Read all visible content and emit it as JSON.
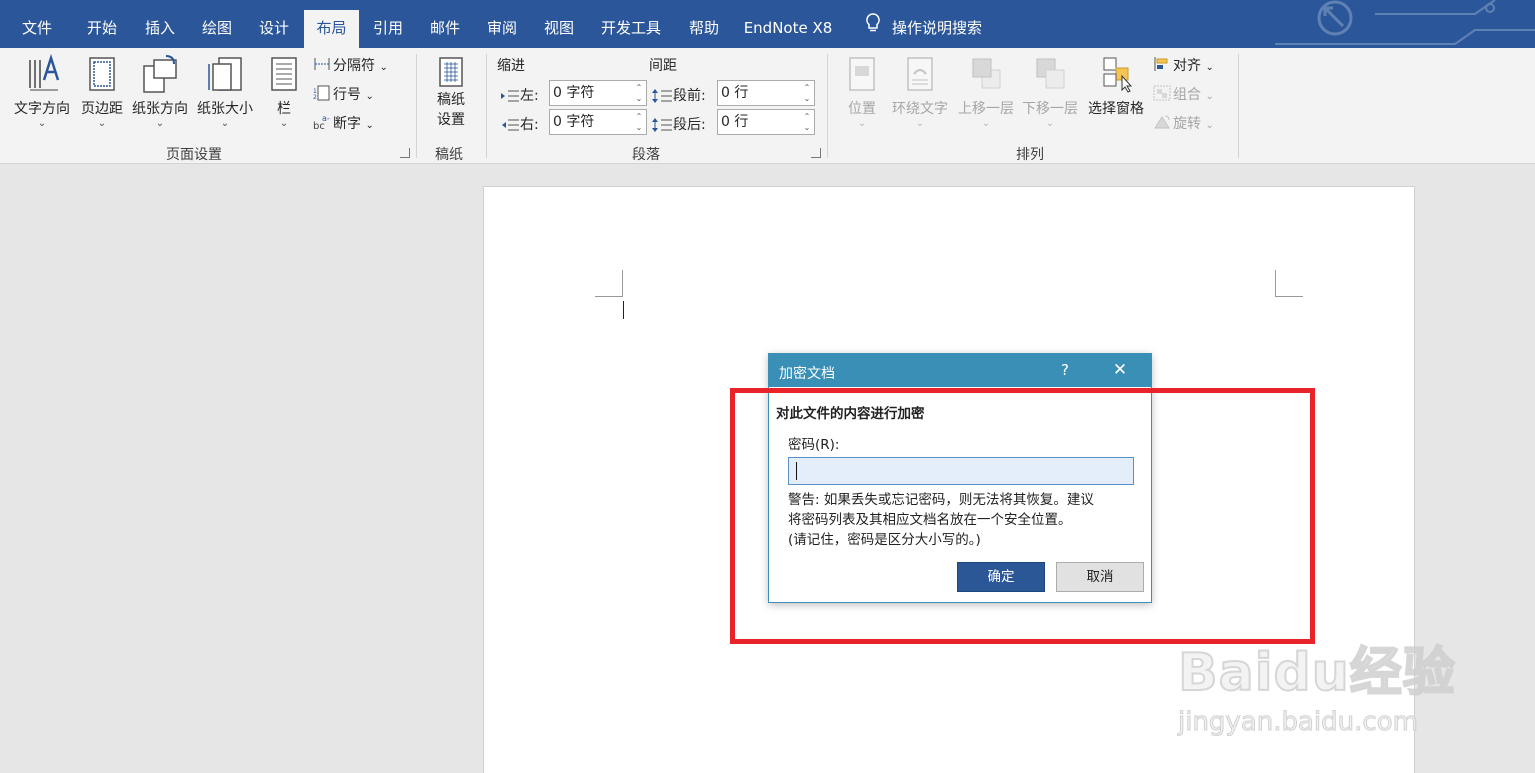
{
  "tabs": [
    "文件",
    "开始",
    "插入",
    "绘图",
    "设计",
    "布局",
    "引用",
    "邮件",
    "审阅",
    "视图",
    "开发工具",
    "帮助",
    "EndNote X8"
  ],
  "active_tab": "布局",
  "tell_me": "操作说明搜索",
  "ribbon": {
    "page_setup": {
      "text_direction": "文字方向",
      "margins": "页边距",
      "orientation": "纸张方向",
      "size": "纸张大小",
      "columns": "栏",
      "breaks": "分隔符",
      "line_numbers": "行号",
      "hyphenation": "断字",
      "group_label": "页面设置"
    },
    "draft_paper": {
      "button_line1": "稿纸",
      "button_line2": "设置",
      "group_label": "稿纸"
    },
    "paragraph": {
      "indent_label": "缩进",
      "spacing_label": "间距",
      "left_label": "左:",
      "right_label": "右:",
      "before_label": "段前:",
      "after_label": "段后:",
      "left_value": "0 字符",
      "right_value": "0 字符",
      "before_value": "0 行",
      "after_value": "0 行",
      "group_label": "段落"
    },
    "arrange": {
      "position": "位置",
      "wrap_text": "环绕文字",
      "bring_forward": "上移一层",
      "send_backward": "下移一层",
      "selection_pane": "选择窗格",
      "align": "对齐",
      "group": "组合",
      "rotate": "旋转",
      "group_label": "排列"
    }
  },
  "dialog": {
    "title": "加密文档",
    "help": "?",
    "heading": "对此文件的内容进行加密",
    "password_label": "密码(R):",
    "password_value": "",
    "warning_lines": [
      "警告: 如果丢失或忘记密码，则无法将其恢复。建议",
      "将密码列表及其相应文档名放在一个安全位置。",
      "(请记住，密码是区分大小写的。)"
    ],
    "ok": "确定",
    "cancel": "取消"
  },
  "watermark": {
    "logo": "Baidu经验",
    "url": "jingyan.baidu.com"
  },
  "colors": {
    "tabbar": "#2b579a",
    "dialog_title": "#3a8fb7",
    "highlight": "#e8232a",
    "ok_button": "#2b5797"
  }
}
